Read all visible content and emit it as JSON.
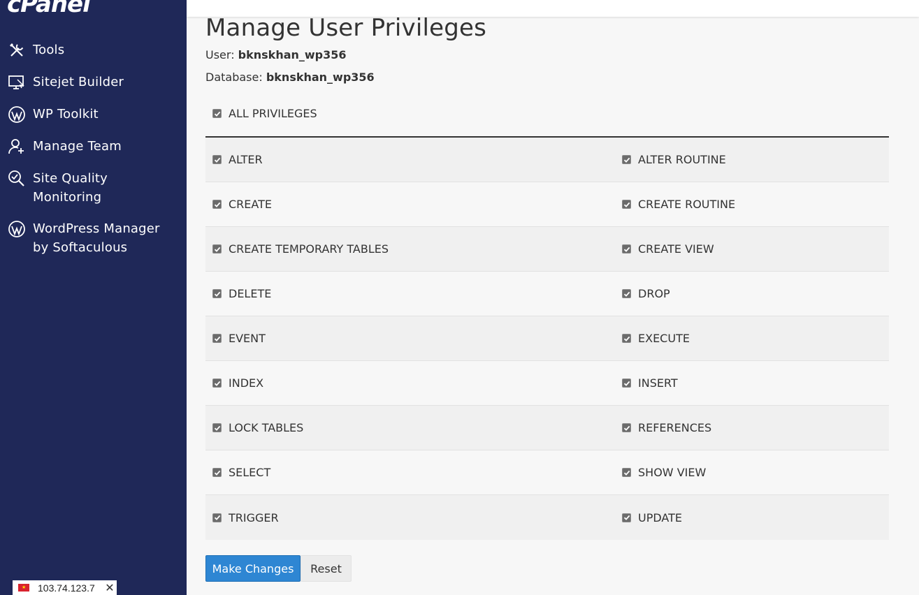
{
  "app": {
    "logo_text": "cPanel"
  },
  "sidebar": {
    "items": [
      {
        "label_lines": [
          "Tools"
        ],
        "icon": "tools-icon"
      },
      {
        "label_lines": [
          "Sitejet Builder"
        ],
        "icon": "monitor-icon"
      },
      {
        "label_lines": [
          "WP Toolkit"
        ],
        "icon": "wordpress-icon"
      },
      {
        "label_lines": [
          "Manage Team"
        ],
        "icon": "user-plus-icon"
      },
      {
        "label_lines": [
          "Site Quality",
          "Monitoring"
        ],
        "icon": "magnifier-check-icon"
      },
      {
        "label_lines": [
          "WordPress Manager",
          "by Softaculous"
        ],
        "icon": "wordpress-icon"
      }
    ]
  },
  "ip_badge": {
    "ip": "103.74.123.7",
    "close": "✕"
  },
  "page": {
    "title": "Manage User Privileges",
    "user_label": "User:",
    "user_value": "bknskhan_wp356",
    "database_label": "Database:",
    "database_value": "bknskhan_wp356",
    "all_privileges": {
      "label": "ALL PRIVILEGES",
      "checked": true
    }
  },
  "privileges": [
    {
      "left": "ALTER",
      "right": "ALTER ROUTINE"
    },
    {
      "left": "CREATE",
      "right": "CREATE ROUTINE"
    },
    {
      "left": "CREATE TEMPORARY TABLES",
      "right": "CREATE VIEW"
    },
    {
      "left": "DELETE",
      "right": "DROP"
    },
    {
      "left": "EVENT",
      "right": "EXECUTE"
    },
    {
      "left": "INDEX",
      "right": "INSERT"
    },
    {
      "left": "LOCK TABLES",
      "right": "REFERENCES"
    },
    {
      "left": "SELECT",
      "right": "SHOW VIEW"
    },
    {
      "left": "TRIGGER",
      "right": "UPDATE"
    }
  ],
  "actions": {
    "make_changes": "Make Changes",
    "reset": "Reset"
  },
  "colors": {
    "sidebar_bg": "#1f2858",
    "primary": "#2e86d3"
  }
}
